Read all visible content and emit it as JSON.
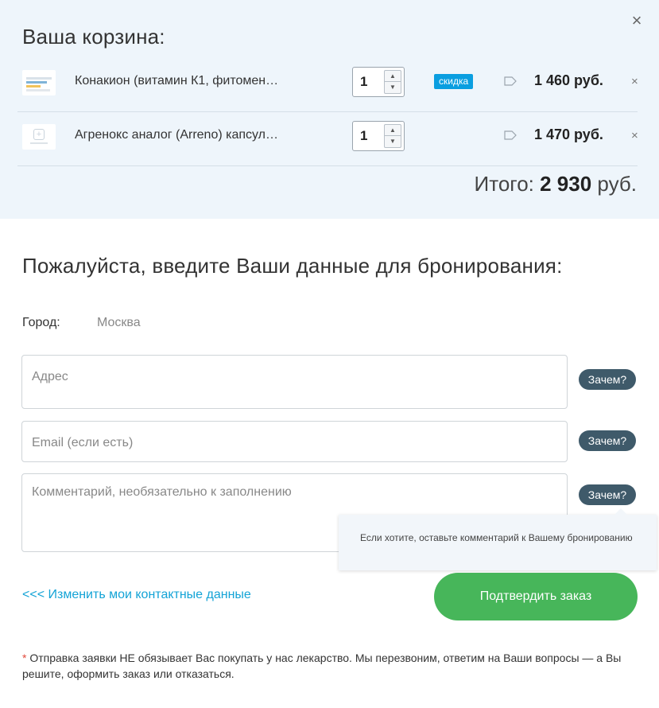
{
  "cart": {
    "title": "Ваша корзина:",
    "close_label": "×",
    "items": [
      {
        "name": "Конакион (витамин К1, фитомен…",
        "quantity": "1",
        "badge": "скидка",
        "price": "1 460 руб.",
        "remove_label": "×"
      },
      {
        "name": "Агренокс аналог (Arreno) капсул…",
        "quantity": "1",
        "price": "1 470 руб.",
        "remove_label": "×"
      }
    ],
    "total": {
      "label": "Итого:",
      "amount": "2 930",
      "currency": "руб."
    }
  },
  "booking": {
    "title": "Пожалуйста, введите Ваши данные для бронирования:",
    "city_label": "Город:",
    "city_value": "Москва",
    "address_placeholder": "Адрес",
    "email_placeholder": "Email (если есть)",
    "comment_placeholder": "Комментарий, необязательно к заполнению",
    "why_label": "Зачем?",
    "tooltip_text": "Если хотите, оставьте комментарий к Вашему бронированию",
    "change_link": "<<< Изменить мои контактные данные",
    "confirm_button": "Подтвердить заказ",
    "note_star": "*",
    "note_text": " Отправка заявки НЕ обязывает Вас покупать у нас лекарство. Мы перезвоним, ответим на Ваши вопросы — а Вы решите, оформить заказ или отказаться."
  },
  "colors": {
    "cart_background": "#eef5fb",
    "badge": "#0a9ee0",
    "why_button": "#3f5a6a",
    "link": "#13a3d6",
    "confirm_button": "#47b65a",
    "note_star": "#e24a3c"
  },
  "icons": {
    "close": "close-icon",
    "tag": "price-tag-icon",
    "spin_up": "arrow-up-icon",
    "spin_down": "arrow-down-icon"
  }
}
